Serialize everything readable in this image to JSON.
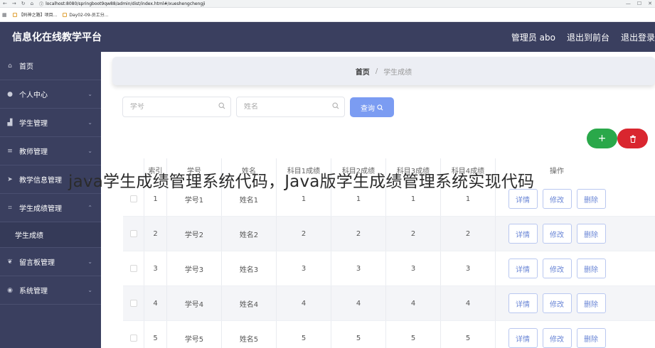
{
  "browser": {
    "url": "localhost:8080/springboot9qw88/admin/dist/index.html#/xueshengchengji",
    "bookmarks": [
      "【码神之路】项目...",
      "Day02-09-员工分..."
    ]
  },
  "header": {
    "title": "信息化在线教学平台",
    "user": "管理员 abo",
    "back_front": "退出到前台",
    "logout": "退出登录"
  },
  "sidebar": {
    "items": [
      {
        "label": "首页",
        "icon": "home-icon"
      },
      {
        "label": "个人中心",
        "icon": "person-icon"
      },
      {
        "label": "学生管理",
        "icon": "chart-icon"
      },
      {
        "label": "教师管理",
        "icon": "list-icon"
      },
      {
        "label": "教学信息管理",
        "icon": "send-icon"
      },
      {
        "label": "学生成绩管理",
        "icon": "crop-icon"
      },
      {
        "label": "留言板管理",
        "icon": "leaf-icon"
      },
      {
        "label": "系统管理",
        "icon": "location-icon"
      }
    ],
    "sub_item": "学生成绩"
  },
  "breadcrumb": {
    "home": "首页",
    "sep": "/",
    "current": "学生成绩"
  },
  "search": {
    "student_no_placeholder": "学号",
    "name_placeholder": "姓名",
    "query_label": "查询"
  },
  "actions": {
    "add_icon": "+",
    "delete_icon": "trash-icon"
  },
  "table": {
    "headers": [
      "索引",
      "学号",
      "姓名",
      "科目1成绩",
      "科目2成绩",
      "科目3成绩",
      "科目4成绩",
      "操作"
    ],
    "rows": [
      {
        "idx": "1",
        "no": "学号1",
        "name": "姓名1",
        "s1": "1",
        "s2": "1",
        "s3": "1",
        "s4": "1"
      },
      {
        "idx": "2",
        "no": "学号2",
        "name": "姓名2",
        "s1": "2",
        "s2": "2",
        "s3": "2",
        "s4": "2"
      },
      {
        "idx": "3",
        "no": "学号3",
        "name": "姓名3",
        "s1": "3",
        "s2": "3",
        "s3": "3",
        "s4": "3"
      },
      {
        "idx": "4",
        "no": "学号4",
        "name": "姓名4",
        "s1": "4",
        "s2": "4",
        "s3": "4",
        "s4": "4"
      },
      {
        "idx": "5",
        "no": "学号5",
        "name": "姓名5",
        "s1": "5",
        "s2": "5",
        "s3": "5",
        "s4": "5"
      }
    ],
    "ops": {
      "detail": "详情",
      "edit": "修改",
      "delete": "删除"
    }
  },
  "watermark": "java学生成绩管理系统代码，Java版学生成绩管理系统实现代码",
  "colors": {
    "header_bg": "#3a3f5f",
    "query_button": "#7b9cf2",
    "add_button": "#2aa84a",
    "delete_button": "#d9262f",
    "op_button_text": "#6a86d6"
  }
}
